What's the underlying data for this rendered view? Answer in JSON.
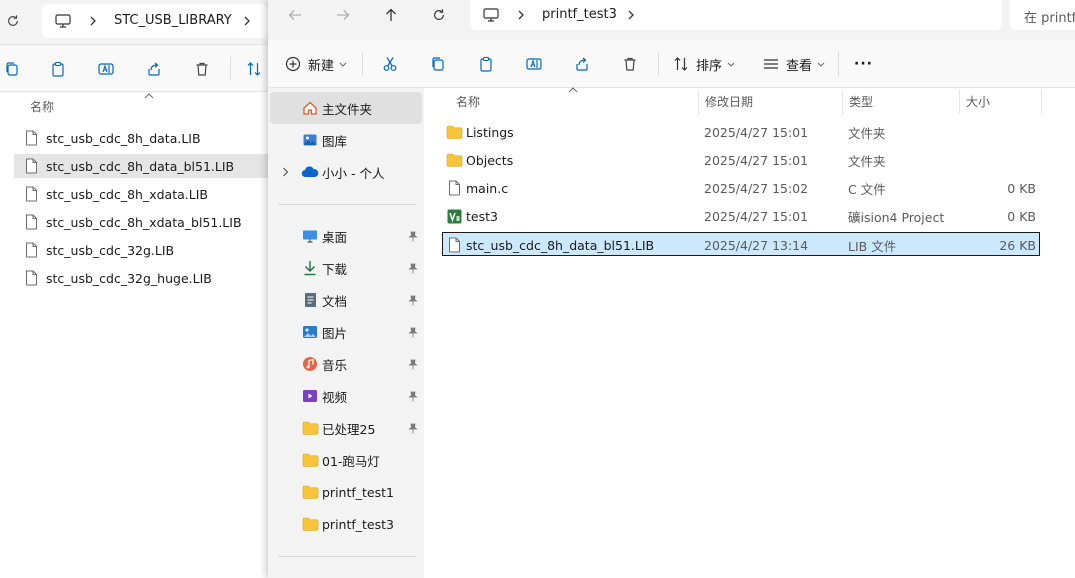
{
  "back_window": {
    "address": "STC_USB_LIBRARY",
    "column_name": "名称",
    "files": [
      {
        "name": "stc_usb_cdc_8h_data.LIB",
        "selected": false
      },
      {
        "name": "stc_usb_cdc_8h_data_bl51.LIB",
        "selected": true
      },
      {
        "name": "stc_usb_cdc_8h_xdata.LIB",
        "selected": false
      },
      {
        "name": "stc_usb_cdc_8h_xdata_bl51.LIB",
        "selected": false
      },
      {
        "name": "stc_usb_cdc_32g.LIB",
        "selected": false
      },
      {
        "name": "stc_usb_cdc_32g_huge.LIB",
        "selected": false
      }
    ]
  },
  "front_window": {
    "address": "printf_test3",
    "search_placeholder": "在 printf",
    "toolbar": {
      "new_label": "新建",
      "sort_label": "排序",
      "view_label": "查看",
      "more_label": "···"
    },
    "nav": {
      "home": "主文件夹",
      "gallery": "图库",
      "onedrive": "小小 - 个人",
      "quick": [
        {
          "label": "桌面",
          "icon": "desktop-icon",
          "pinned": true
        },
        {
          "label": "下载",
          "icon": "download-icon",
          "pinned": true
        },
        {
          "label": "文档",
          "icon": "document-icon",
          "pinned": true
        },
        {
          "label": "图片",
          "icon": "pictures-icon",
          "pinned": true
        },
        {
          "label": "音乐",
          "icon": "music-icon",
          "pinned": true
        },
        {
          "label": "视频",
          "icon": "video-icon",
          "pinned": true
        },
        {
          "label": "已处理25",
          "icon": "folder-icon",
          "pinned": true
        },
        {
          "label": "01-跑马灯",
          "icon": "folder-icon",
          "pinned": false
        },
        {
          "label": "printf_test1",
          "icon": "folder-icon",
          "pinned": false
        },
        {
          "label": "printf_test3",
          "icon": "folder-icon",
          "pinned": false
        }
      ]
    },
    "columns": {
      "name": "名称",
      "date": "修改日期",
      "type": "类型",
      "size": "大小"
    },
    "files": [
      {
        "name": "Listings",
        "date": "2025/4/27 15:01",
        "type": "文件夹",
        "size": "",
        "icon": "folder-icon",
        "selected": false
      },
      {
        "name": "Objects",
        "date": "2025/4/27 15:01",
        "type": "文件夹",
        "size": "",
        "icon": "folder-icon",
        "selected": false
      },
      {
        "name": "main.c",
        "date": "2025/4/27 15:02",
        "type": "C 文件",
        "size": "0 KB",
        "icon": "file-icon",
        "selected": false
      },
      {
        "name": "test3",
        "date": "2025/4/27 15:01",
        "type": "礦ision4 Project",
        "size": "0 KB",
        "icon": "uvision-project-icon",
        "selected": false
      },
      {
        "name": "stc_usb_cdc_8h_data_bl51.LIB",
        "date": "2025/4/27 13:14",
        "type": "LIB 文件",
        "size": "26 KB",
        "icon": "file-icon",
        "selected": true
      }
    ]
  },
  "colors": {
    "selection": "#cce8ff",
    "folder": "#f8c53a",
    "accent": "#0067c0"
  }
}
